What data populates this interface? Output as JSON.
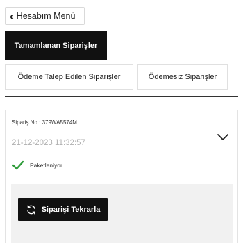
{
  "header": {
    "menu_button_label": "Hesabım Menü",
    "menu_icon": "double-chevron-left-icon"
  },
  "tabs": {
    "active_label": "Tamamlanan Siparişler",
    "items": [
      {
        "label": "Ödeme Talep Edilen Siparişler"
      },
      {
        "label": "Ödemesiz Siparişler"
      }
    ]
  },
  "order": {
    "number_label": "Sipariş No : 379WA5574M",
    "date": "21-12-2023 11:32:57",
    "status_text": "Paketleniyor",
    "status_icon": "check-icon",
    "expand_icon": "chevron-down-icon",
    "reorder_label": "Siparişi Tekrarla",
    "reorder_icon": "refresh-icon"
  },
  "colors": {
    "primary": "#111111",
    "status_check": "#2e9c3a",
    "panel_bg": "#f1f1f1"
  }
}
